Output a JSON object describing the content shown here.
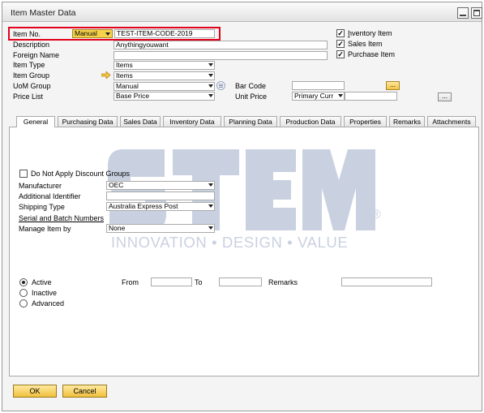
{
  "window": {
    "title": "Item Master Data"
  },
  "header": {
    "item_no_label": "Item No.",
    "item_no_mode": "Manual",
    "item_no_value": "TEST-ITEM-CODE-2019",
    "description_label": "Description",
    "description_value": "Anythingyouwant",
    "foreign_name_label": "Foreign Name",
    "foreign_name_value": "",
    "item_type_label": "Item Type",
    "item_type_value": "Items",
    "item_group_label": "Item Group",
    "item_group_value": "Items",
    "uom_group_label": "UoM Group",
    "uom_group_value": "Manual",
    "price_list_label": "Price List",
    "price_list_value": "Base Price",
    "bar_code_label": "Bar Code",
    "bar_code_value": "",
    "unit_price_label": "Unit Price",
    "unit_price_currency": "Primary Curr",
    "unit_price_value": "",
    "ellipsis": "...",
    "inventory_item_label": "Inventory Item",
    "sales_item_label": "Sales Item",
    "purchase_item_label": "Purchase Item",
    "check_mark": "✓"
  },
  "tabs": [
    "General",
    "Purchasing Data",
    "Sales Data",
    "Inventory Data",
    "Planning Data",
    "Production Data",
    "Properties",
    "Remarks",
    "Attachments"
  ],
  "general": {
    "no_discount_label": "Do Not Apply Discount Groups",
    "manufacturer_label": "Manufacturer",
    "manufacturer_value": "OEC",
    "additional_identifier_label": "Additional Identifier",
    "additional_identifier_value": "",
    "shipping_type_label": "Shipping Type",
    "shipping_type_value": "Australia Express Post",
    "serial_batch_label": "Serial and Batch Numbers",
    "manage_item_by_label": "Manage Item by",
    "manage_item_by_value": "None",
    "active_label": "Active",
    "inactive_label": "Inactive",
    "advanced_label": "Advanced",
    "from_label": "From",
    "to_label": "To",
    "remarks_label": "Remarks"
  },
  "footer": {
    "ok_label": "OK",
    "cancel_label": "Cancel"
  },
  "watermark": {
    "brand": "STEM",
    "reg": "®",
    "tagline": "INNOVATION • DESIGN • VALUE"
  },
  "colors": {
    "highlight": "#e3001b",
    "gold_button": "#f3c447",
    "watermark": "#c9d1e1"
  }
}
